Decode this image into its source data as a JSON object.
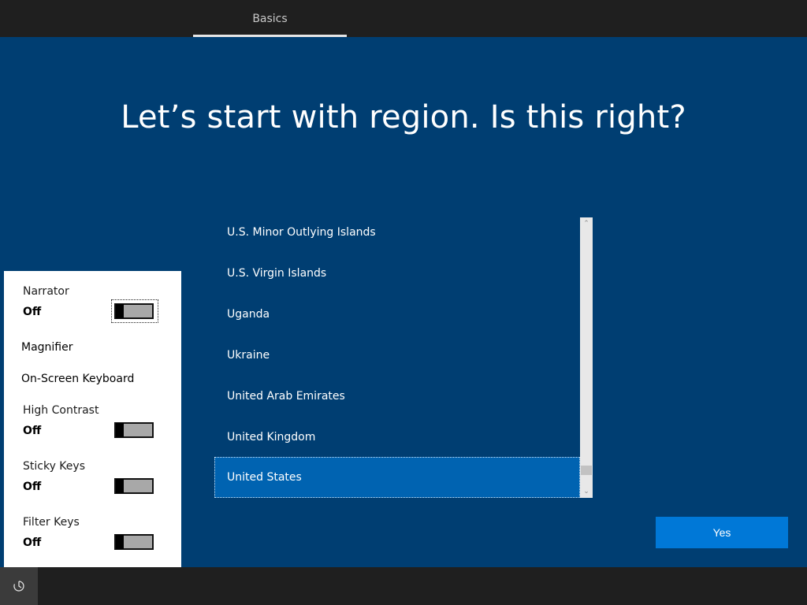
{
  "tabs": [
    {
      "label": "Basics"
    }
  ],
  "title": "Let’s start with region. Is this right?",
  "regions": [
    {
      "label": "U.S. Minor Outlying Islands",
      "selected": false
    },
    {
      "label": "U.S. Virgin Islands",
      "selected": false
    },
    {
      "label": "Uganda",
      "selected": false
    },
    {
      "label": "Ukraine",
      "selected": false
    },
    {
      "label": "United Arab Emirates",
      "selected": false
    },
    {
      "label": "United Kingdom",
      "selected": false
    },
    {
      "label": "United States",
      "selected": true
    }
  ],
  "scrollbar": {
    "up_glyph": "⌃",
    "down_glyph": "⌄"
  },
  "yes_label": "Yes",
  "accessibility": {
    "narrator": {
      "label": "Narrator",
      "state": "Off"
    },
    "magnifier": {
      "label": "Magnifier"
    },
    "onscreen_keyboard": {
      "label": "On-Screen Keyboard"
    },
    "high_contrast": {
      "label": "High Contrast",
      "state": "Off"
    },
    "sticky_keys": {
      "label": "Sticky Keys",
      "state": "Off"
    },
    "filter_keys": {
      "label": "Filter Keys",
      "state": "Off"
    }
  },
  "icons": {
    "accessibility": "ease-of-access-icon"
  },
  "colors": {
    "background": "#003e72",
    "selected": "#0063b1",
    "accent": "#0078d7"
  }
}
